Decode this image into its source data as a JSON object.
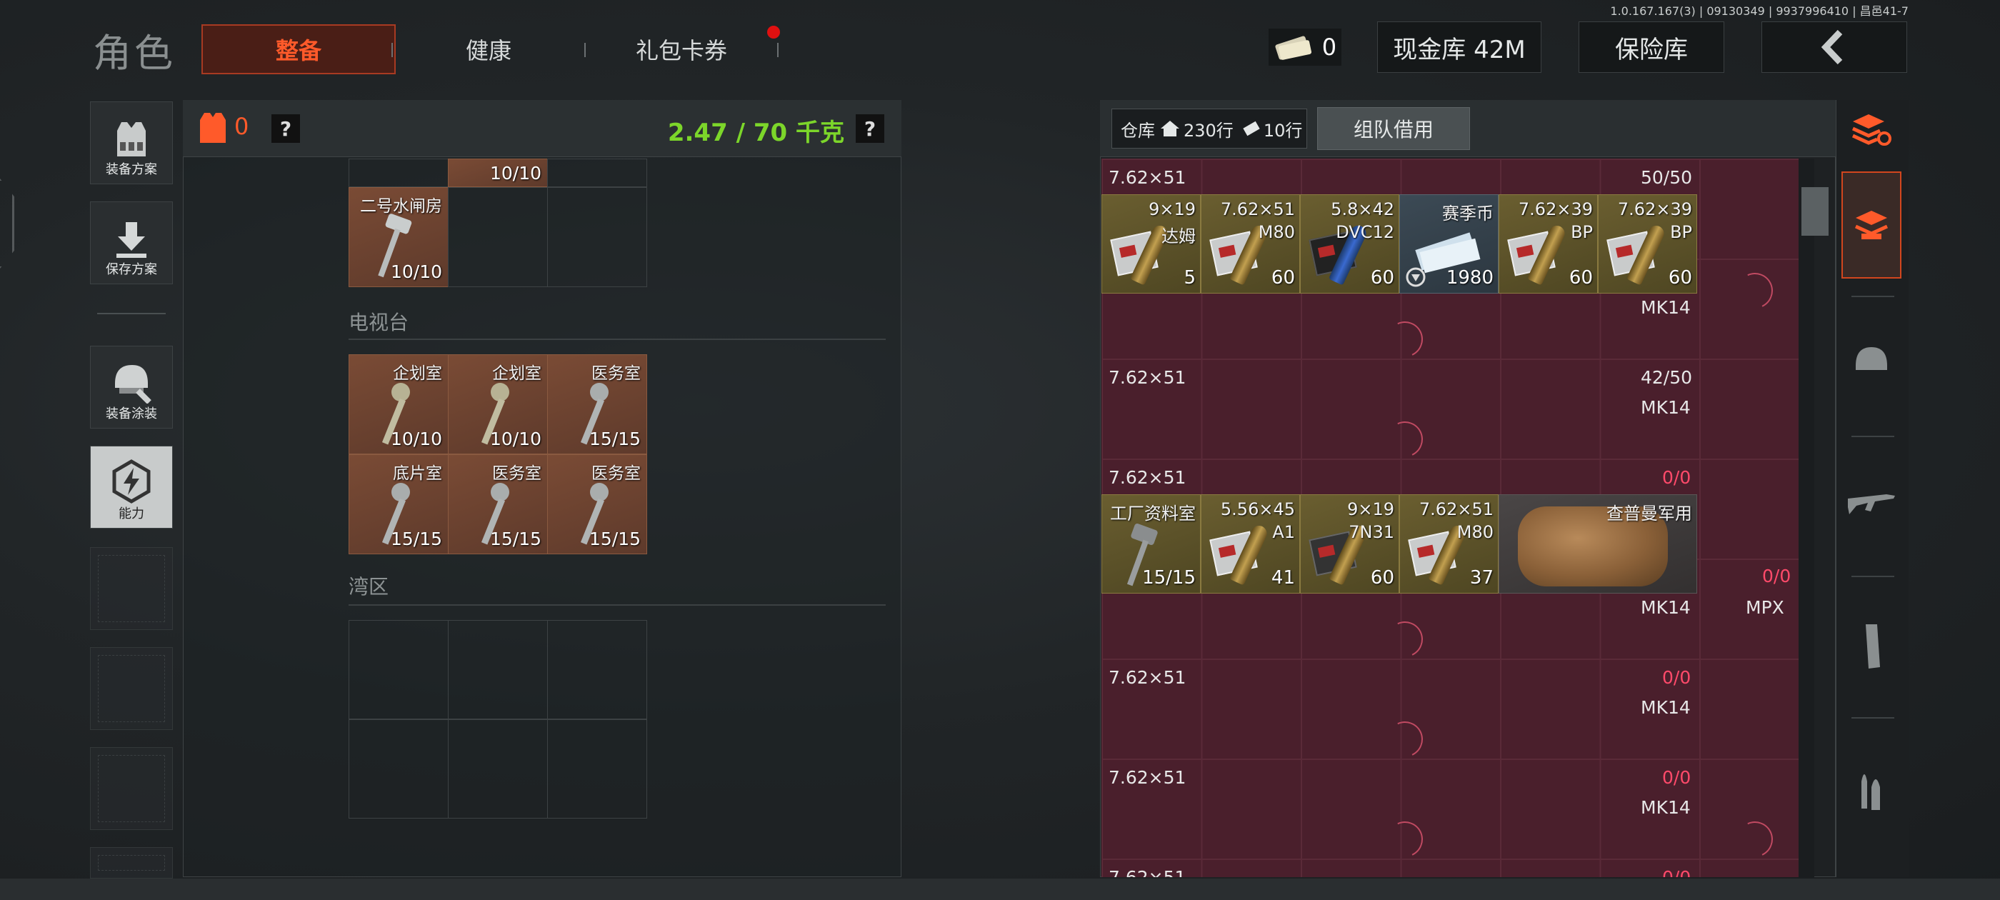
{
  "version": "1.0.167.167(3) | 09130349 | 9937996410 | 昌邑41-7",
  "header": {
    "title": "角色",
    "tabs": [
      {
        "label": "整备",
        "active": true
      },
      {
        "label": "健康",
        "active": false
      },
      {
        "label": "礼包卡券",
        "active": false,
        "has_notification": true
      }
    ],
    "cash_count": "0",
    "cash_stash_label": "现金库 42M",
    "vault_label": "保险库",
    "back_icon": "chevron-left-icon"
  },
  "left_sidebar": {
    "items": [
      {
        "label": "装备方案",
        "icon": "vest-icon"
      },
      {
        "label": "保存方案",
        "icon": "download-icon"
      },
      {
        "label": "装备涂装",
        "icon": "helmet-icon"
      },
      {
        "label": "能力",
        "icon": "lightning-icon",
        "selected": true
      }
    ]
  },
  "left_panel": {
    "armor_count": "0",
    "weight": "2.47 / 70 千克",
    "top_key": {
      "count": "10/10"
    },
    "keys_top": [
      {
        "name": "二号水闸房",
        "count": "10/10"
      }
    ],
    "sections": [
      {
        "title": "电视台",
        "keys": [
          {
            "name": "企划室",
            "count": "10/10"
          },
          {
            "name": "企划室",
            "count": "10/10"
          },
          {
            "name": "医务室",
            "count": "15/15"
          },
          {
            "name": "底片室",
            "count": "15/15"
          },
          {
            "name": "医务室",
            "count": "15/15"
          },
          {
            "name": "医务室",
            "count": "15/15"
          }
        ]
      },
      {
        "title": "湾区",
        "keys": []
      }
    ]
  },
  "stash": {
    "label": "仓库",
    "rows_label": "230行",
    "tickets_label": "10行",
    "team_borrow": "组队借用",
    "row1": {
      "caliber": "7.62×51",
      "count": "50/50"
    },
    "ammo_row": [
      {
        "caliber": "9×19",
        "type": "达姆",
        "count": "5"
      },
      {
        "caliber": "7.62×51",
        "type": "M80",
        "count": "60"
      },
      {
        "caliber": "5.8×42",
        "type": "DVC12",
        "count": "60"
      },
      {
        "caliber": "赛季币",
        "type": "",
        "count": "1980"
      },
      {
        "caliber": "7.62×39",
        "type": "BP",
        "count": "60"
      },
      {
        "caliber": "7.62×39",
        "type": "BP",
        "count": "60"
      }
    ],
    "mags": [
      {
        "weapon": "MK14",
        "caliber": "7.62×51",
        "count": "42/50"
      },
      {
        "weapon": "MK14",
        "caliber": "7.62×51",
        "count": "0/0"
      }
    ],
    "mixed_row": [
      {
        "caliber": "工厂资料室",
        "type": "",
        "count": "15/15"
      },
      {
        "caliber": "5.56×45",
        "type": "A1",
        "count": "41"
      },
      {
        "caliber": "9×19",
        "type": "7N31",
        "count": "60"
      },
      {
        "caliber": "7.62×51",
        "type": "M80",
        "count": "37"
      }
    ],
    "bag": {
      "name": "查普曼军用"
    },
    "mixed_right_count": "0/0",
    "lower_mags": [
      {
        "weapon": "MK14",
        "caliber": "7.62×51",
        "count": "0/0",
        "extra": "MPX"
      },
      {
        "weapon": "MK14",
        "caliber": "7.62×51",
        "count": "0/0"
      },
      {
        "weapon": "MK14",
        "caliber": "7.62×51",
        "count": "0/0"
      }
    ]
  },
  "colors": {
    "accent": "#ff5a2a",
    "weight": "#7cd62a",
    "zero": "#ff4a6a"
  }
}
